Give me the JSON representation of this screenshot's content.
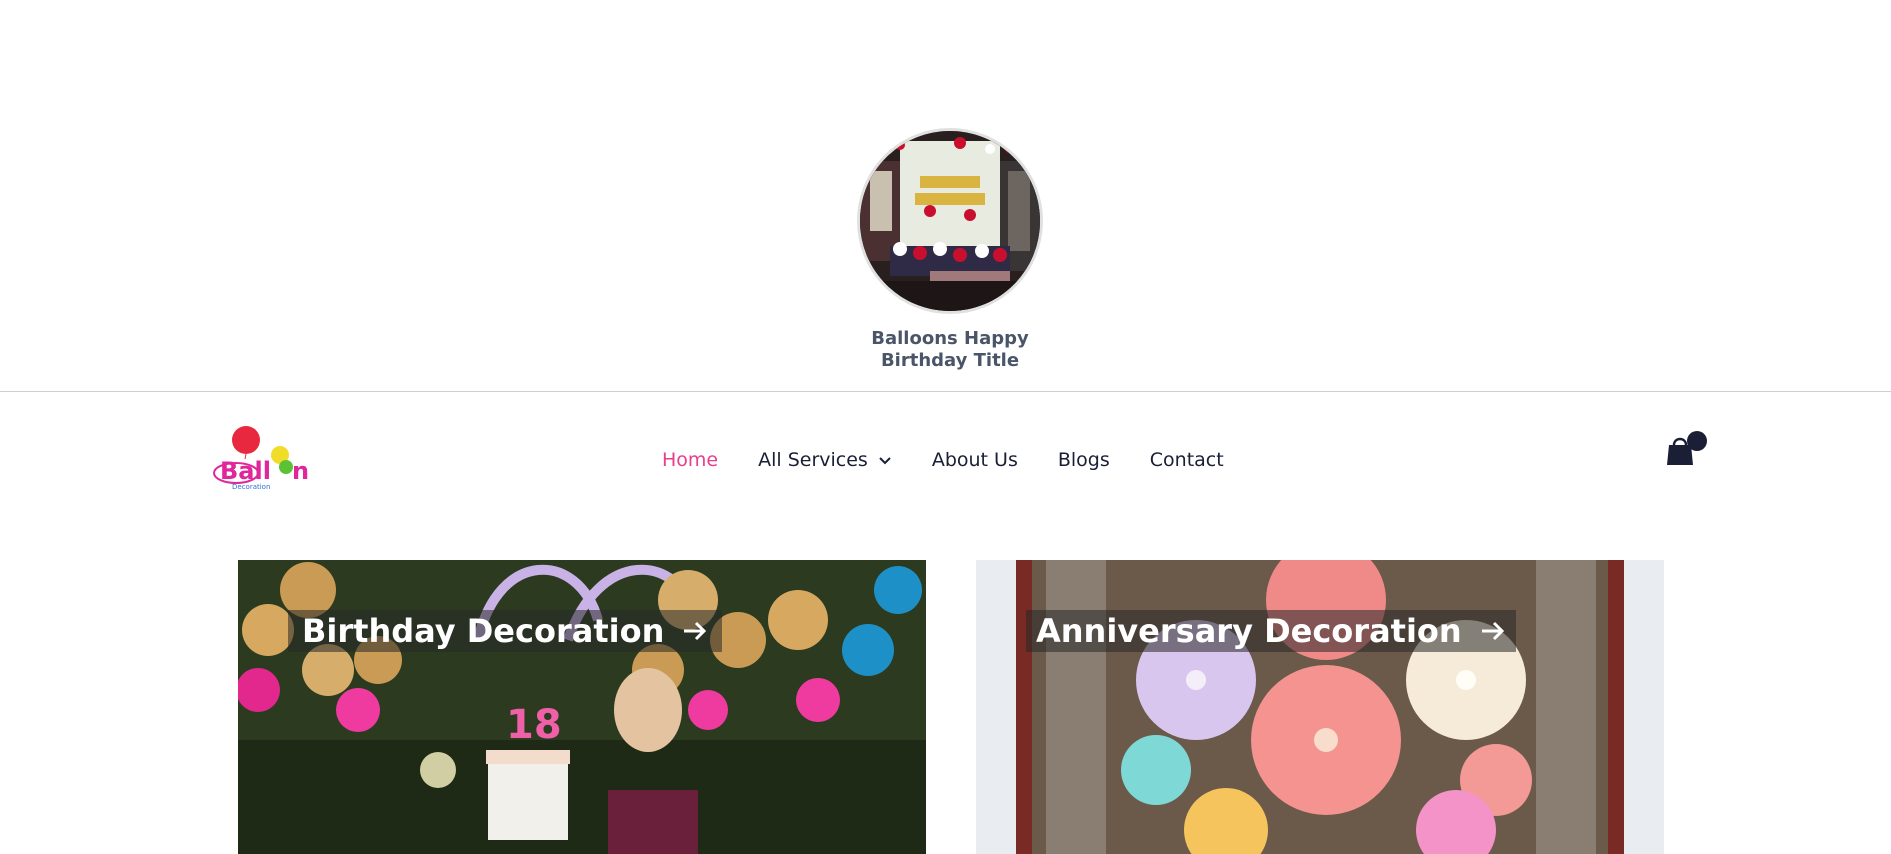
{
  "profile": {
    "title_line1": "Balloons Happy",
    "title_line2": "Birthday Title",
    "avatar_icon": "birthday-room-photo"
  },
  "logo": {
    "text": "Ball",
    "text_end": "n",
    "sub": "Decoration",
    "colors": {
      "red": "#e8283f",
      "pink": "#e0269a",
      "blue": "#2f6fd6",
      "yellow": "#f2dc2a",
      "green": "#5bc236"
    }
  },
  "nav": {
    "items": [
      {
        "label": "Home",
        "active": true
      },
      {
        "label": "All Services",
        "has_dropdown": true
      },
      {
        "label": "About Us"
      },
      {
        "label": "Blogs"
      },
      {
        "label": "Contact"
      }
    ],
    "active_color": "#e83e8c",
    "text_color": "#1a1f36"
  },
  "cart": {
    "icon": "shopping-bag-icon",
    "count_badge": "0"
  },
  "cards": [
    {
      "label": "Birthday Decoration",
      "icon": "arrow-right-icon"
    },
    {
      "label": "Anniversary Decoration",
      "icon": "arrow-right-icon"
    }
  ]
}
